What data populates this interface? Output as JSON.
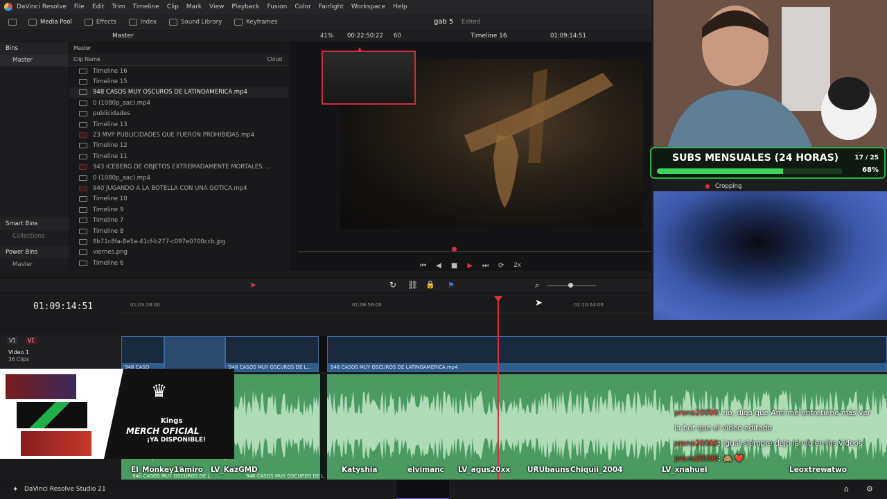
{
  "menu": {
    "app": "DaVinci Resolve",
    "items": [
      "File",
      "Edit",
      "Trim",
      "Timeline",
      "Clip",
      "Mark",
      "View",
      "Playback",
      "Fusion",
      "Color",
      "Fairlight",
      "Workspace",
      "Help"
    ]
  },
  "toolbar": {
    "media_pool": "Media Pool",
    "effects": "Effects",
    "index": "Index",
    "sound_library": "Sound Library",
    "keyframes": "Keyframes",
    "project_name": "gab 5",
    "project_status": "Edited"
  },
  "viewer_bar": {
    "pool_title": "Master",
    "zoom": "41%",
    "timecode": "00:22:50:22",
    "fps": "60",
    "timeline_name": "Timeline 16",
    "timeline_tc": "01:09:14:51"
  },
  "bins": {
    "header": "Bins",
    "master": "Master",
    "smart_bins": "Smart Bins",
    "collections": "Collections",
    "power_bins": "Power Bins",
    "power_master": "Master"
  },
  "clip_list": {
    "breadcrumb": "Master",
    "col_name": "Clip Name",
    "col_cloud": "Cloud",
    "items": [
      {
        "name": "Timeline 16",
        "type": "timeline"
      },
      {
        "name": "Timeline 15",
        "type": "timeline"
      },
      {
        "name": "948 CASOS MUY OSCUROS DE LATINOAMERICA.mp4",
        "type": "video",
        "selected": true
      },
      {
        "name": "0 (1080p_aac).mp4",
        "type": "video"
      },
      {
        "name": "publicidades",
        "type": "timeline"
      },
      {
        "name": "Timeline 13",
        "type": "timeline"
      },
      {
        "name": "23 MVP PUBLICIDADES QUE FUERON PROHIBIDAS.mp4",
        "type": "red"
      },
      {
        "name": "Timeline 12",
        "type": "timeline"
      },
      {
        "name": "Timeline 11",
        "type": "timeline"
      },
      {
        "name": "943 ICEBERG DE OBJETOS EXTREMADAMENTE MORTALES....",
        "type": "red"
      },
      {
        "name": "0 (1080p_aac).mp4",
        "type": "video"
      },
      {
        "name": "940 JUGANDO A LA BOTELLA CON UNA GOTICA.mp4",
        "type": "red"
      },
      {
        "name": "Timeline 10",
        "type": "timeline"
      },
      {
        "name": "Timeline 9",
        "type": "timeline"
      },
      {
        "name": "Timeline 7",
        "type": "timeline"
      },
      {
        "name": "Timeline 8",
        "type": "timeline"
      },
      {
        "name": "8b71c8fa-8e5a-41cf-b277-c097e0700ccb.jpg",
        "type": "image"
      },
      {
        "name": "viernes.png",
        "type": "image"
      },
      {
        "name": "Timeline 6",
        "type": "timeline"
      }
    ]
  },
  "transport": {
    "speed": "2x"
  },
  "timeline": {
    "current_tc": "01:09:14:51",
    "ruler": [
      "01:03:28:00",
      "01:06:56:00",
      "01:10:24:00"
    ],
    "v1_badge_a": "V1",
    "v1_badge_b": "V1",
    "track_name": "Video 1",
    "track_count": "36 Clips",
    "clips": [
      {
        "label": "948 CASO"
      },
      {
        "label": "948 CASOS MUY OSCUROS DE L..."
      },
      {
        "label": "948 CASOS MUY OSCUROS DE LATINOAMERICA.mp4"
      }
    ],
    "audio_labels": [
      "948 CASOS MUY OSCUROS DE L",
      "948 CASOS MUY OSCUROS DE L"
    ]
  },
  "overlay": {
    "subs_title": "SUBS MENSUALES (24 HORAS)",
    "subs_count": "17 / 25",
    "subs_pct": "68%",
    "subs_fraction": 0.68,
    "cropping": "Cropping",
    "brand": "Kings",
    "merch_line1": "MERCH OFICIAL",
    "merch_line2": "¡YA DISPONIBLE!"
  },
  "chat": [
    {
      "user": "prono20000",
      "text": ": no, digo que Ami me entretiene más ver"
    },
    {
      "user": "",
      "text": "la bot que el video editado"
    },
    {
      "user": "prono20000",
      "text": ": igual siempre dejo la viu en los videos"
    },
    {
      "user": "prono20000",
      "text": ": 🙈 ❤️"
    }
  ],
  "viewer_names": [
    "El_Monkey19",
    "amiro",
    "LV_KazGMD",
    "Katyshia",
    "elvimanc",
    "LV_agus20xx",
    "URUbauns",
    "Chiquii_2004",
    "LV_xnahuel",
    "Leoxtrew",
    "atwo"
  ],
  "statusbar": {
    "app_name": "DaVinci Resolve Studio 21"
  },
  "colors": {
    "accent_red": "#d8303c",
    "clip_blue": "#2f5d8e",
    "audio_green": "#4a9a62",
    "subs_green": "#3cd65a"
  }
}
